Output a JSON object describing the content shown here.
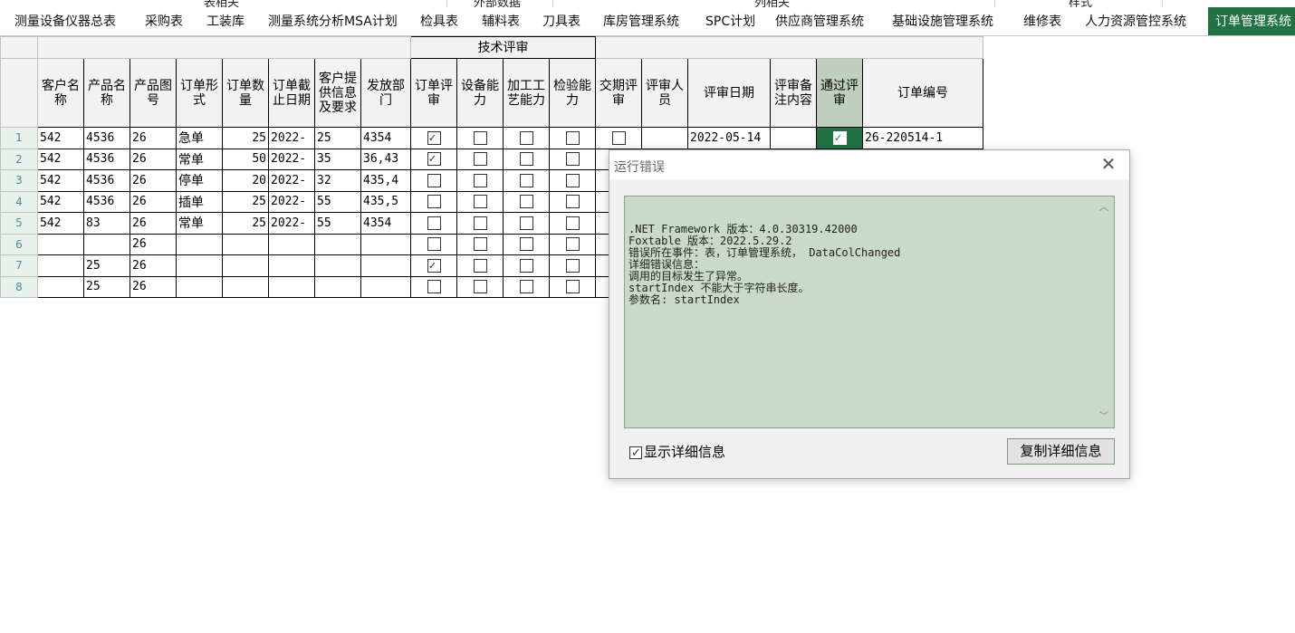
{
  "ribbon_groups": [
    "表相关",
    "外部数据",
    "列相关",
    "样式"
  ],
  "tabs": [
    {
      "label": "测量设备仪器总表"
    },
    {
      "label": "采购表"
    },
    {
      "label": "工装库"
    },
    {
      "label": "测量系统分析MSA计划"
    },
    {
      "label": "检具表"
    },
    {
      "label": "辅料表"
    },
    {
      "label": "刀具表"
    },
    {
      "label": "库房管理系统"
    },
    {
      "label": "SPC计划"
    },
    {
      "label": "供应商管理系统"
    },
    {
      "label": "基础设施管理系统"
    },
    {
      "label": "维修表"
    },
    {
      "label": "人力资源管控系统"
    },
    {
      "label": "订单管理系统",
      "active": true
    }
  ],
  "grid": {
    "group_header": "技术评审",
    "headers": {
      "customer_name": "客户名称",
      "product_name": "产品名称",
      "product_drawing": "产品图号",
      "order_form": "订单形式",
      "order_qty": "订单数量",
      "order_deadline": "订单截止日期",
      "customer_info": "客户提供信息及要求",
      "issue_dept": "发放部门",
      "order_review": "订单评审",
      "equipment_capability": "设备能力",
      "process_capability": "加工工艺能力",
      "inspection_capability": "检验能力",
      "delivery_review": "交期评审",
      "reviewer": "评审人员",
      "review_date": "评审日期",
      "review_notes": "评审备注内容",
      "passed_review": "通过评审",
      "order_no": "订单编号"
    },
    "rows": [
      {
        "n": "1",
        "customer": "542",
        "product": "4536",
        "drawing": "26",
        "form": "急单",
        "qty": "25",
        "deadline": "2022-",
        "info": "25",
        "dept": "4354",
        "order_review": true,
        "equip": false,
        "process": false,
        "inspect": false,
        "delivery": false,
        "reviewer": "",
        "review_date": "2022-05-14",
        "notes": "",
        "passed": true,
        "order_no": "26-220514-1"
      },
      {
        "n": "2",
        "customer": "542",
        "product": "4536",
        "drawing": "26",
        "form": "常单",
        "qty": "50",
        "deadline": "2022-",
        "info": "35",
        "dept": "36,43",
        "order_review": true,
        "equip": false,
        "process": false,
        "inspect": false
      },
      {
        "n": "3",
        "customer": "542",
        "product": "4536",
        "drawing": "26",
        "form": "停单",
        "qty": "20",
        "deadline": "2022-",
        "info": "32",
        "dept": "435,4",
        "order_review": false,
        "equip": false,
        "process": false,
        "inspect": false
      },
      {
        "n": "4",
        "customer": "542",
        "product": "4536",
        "drawing": "26",
        "form": "插单",
        "qty": "25",
        "deadline": "2022-",
        "info": "55",
        "dept": "435,5",
        "order_review": false,
        "equip": false,
        "process": false,
        "inspect": false
      },
      {
        "n": "5",
        "customer": "542",
        "product": "83",
        "drawing": "26",
        "form": "常单",
        "qty": "25",
        "deadline": "2022-",
        "info": "55",
        "dept": "4354",
        "order_review": false,
        "equip": false,
        "process": false,
        "inspect": false
      },
      {
        "n": "6",
        "customer": "",
        "product": "",
        "drawing": "26",
        "form": "",
        "qty": "",
        "deadline": "",
        "info": "",
        "dept": "",
        "order_review": false,
        "equip": false,
        "process": false,
        "inspect": false
      },
      {
        "n": "7",
        "customer": "",
        "product": "25",
        "drawing": "26",
        "form": "",
        "qty": "",
        "deadline": "",
        "info": "",
        "dept": "",
        "order_review": true,
        "equip": false,
        "process": false,
        "inspect": false
      },
      {
        "n": "8",
        "customer": "",
        "product": "25",
        "drawing": "26",
        "form": "",
        "qty": "",
        "deadline": "",
        "info": "",
        "dept": "",
        "order_review": false,
        "equip": false,
        "process": false,
        "inspect": false
      }
    ]
  },
  "dialog": {
    "title": "运行错误",
    "close_icon": "close-icon",
    "detail_lines": [
      ".NET Framework 版本：4.0.30319.42000",
      "Foxtable 版本：2022.5.29.2",
      "错误所在事件：表，订单管理系统， DataColChanged",
      "详细错误信息：",
      "调用的目标发生了异常。",
      "startIndex 不能大于字符串长度。",
      "参数名: startIndex"
    ],
    "show_detail_label": "显示详细信息",
    "show_detail_checked": true,
    "copy_button_label": "复制详细信息"
  }
}
